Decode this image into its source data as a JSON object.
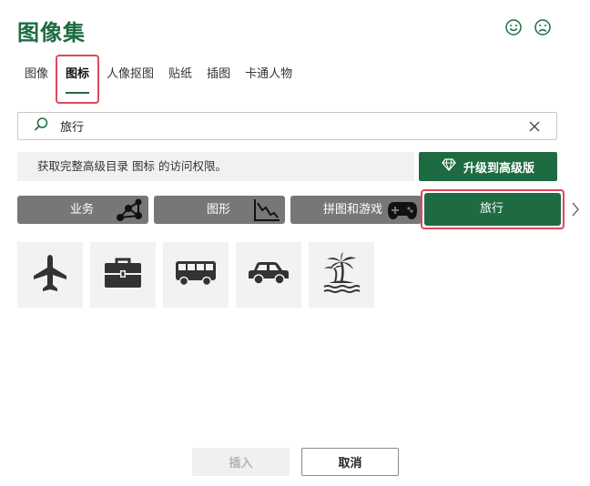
{
  "title": "图像集",
  "feedback": {
    "happy_icon": "smile-icon",
    "sad_icon": "frown-icon"
  },
  "tabs": [
    {
      "label": "图像",
      "active": false
    },
    {
      "label": "图标",
      "active": true
    },
    {
      "label": "人像抠图",
      "active": false
    },
    {
      "label": "贴纸",
      "active": false
    },
    {
      "label": "插图",
      "active": false
    },
    {
      "label": "卡通人物",
      "active": false
    }
  ],
  "search": {
    "value": "旅行",
    "placeholder": "",
    "search_icon": "search-icon",
    "clear_icon": "close-icon"
  },
  "upgrade": {
    "message": "获取完整高级目录 图标 的访问权限。",
    "button_label": "升级到高级版",
    "button_icon": "diamond-icon"
  },
  "categories": [
    {
      "label": "业务",
      "icon": "network-icon",
      "selected": false
    },
    {
      "label": "图形",
      "icon": "chart-down-icon",
      "selected": false
    },
    {
      "label": "拼图和游戏",
      "icon": "gamepad-icon",
      "selected": false
    },
    {
      "label": "旅行",
      "icon": "",
      "selected": true
    }
  ],
  "results": [
    {
      "icon": "airplane-icon"
    },
    {
      "icon": "briefcase-icon"
    },
    {
      "icon": "bus-icon"
    },
    {
      "icon": "car-icon"
    },
    {
      "icon": "palm-island-icon"
    }
  ],
  "colors": {
    "accent": "#1e6b41",
    "highlight": "#e0475c",
    "category_bg": "#777777"
  },
  "footer": {
    "insert_label": "插入",
    "cancel_label": "取消"
  }
}
